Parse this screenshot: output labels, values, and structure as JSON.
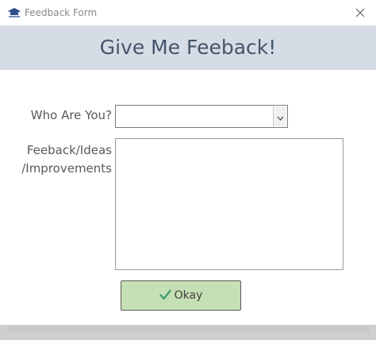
{
  "window": {
    "title": "Feedback Form",
    "header_title": "Give Me Feeback!"
  },
  "form": {
    "who_label": "Who Are You?",
    "who_value": "",
    "feedback_label_line1": "Feeback/Ideas",
    "feedback_label_line2": "/Improvements",
    "feedback_value": ""
  },
  "actions": {
    "okay_label": "Okay"
  },
  "icons": {
    "app": "app-logo-icon",
    "close": "close-icon",
    "dropdown": "chevron-down-icon",
    "okay": "checkmark-icon"
  },
  "colors": {
    "header_band": "#d6dce5",
    "header_text": "#44546a",
    "okay_button": "#c5e0b4",
    "checkmark": "#3f9d6b"
  }
}
